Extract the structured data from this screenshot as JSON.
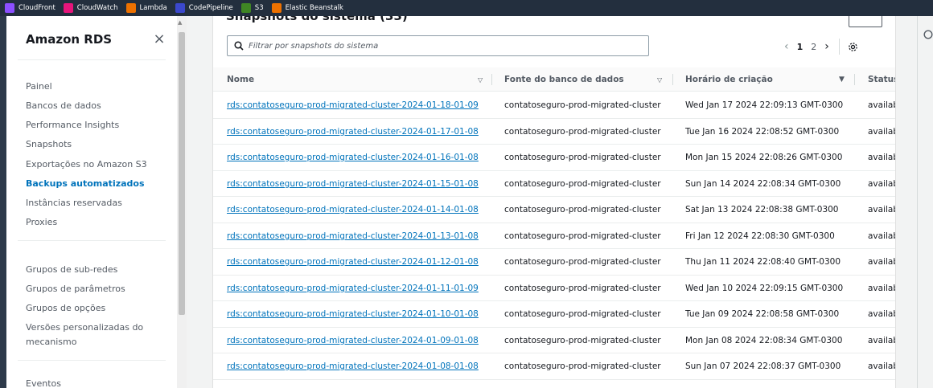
{
  "favorites": [
    {
      "label": "CloudFront",
      "color": "#8c4fff"
    },
    {
      "label": "CloudWatch",
      "color": "#e7157b"
    },
    {
      "label": "Lambda",
      "color": "#ed7100"
    },
    {
      "label": "CodePipeline",
      "color": "#3b48cc"
    },
    {
      "label": "S3",
      "color": "#3f8624"
    },
    {
      "label": "Elastic Beanstalk",
      "color": "#ed7100"
    }
  ],
  "sidebar": {
    "title": "Amazon RDS",
    "close_icon": "×",
    "items": [
      {
        "label": "Painel"
      },
      {
        "label": "Bancos de dados"
      },
      {
        "label": "Performance Insights"
      },
      {
        "label": "Snapshots"
      },
      {
        "label": "Exportações no Amazon S3"
      },
      {
        "label": "Backups automatizados",
        "active": true
      },
      {
        "label": "Instâncias reservadas"
      },
      {
        "label": "Proxies"
      }
    ],
    "items2": [
      {
        "label": "Grupos de sub-redes"
      },
      {
        "label": "Grupos de parâmetros"
      },
      {
        "label": "Grupos de opções"
      },
      {
        "label": "Versões personalizadas do"
      },
      {
        "label": "mecanismo"
      }
    ],
    "items3": [
      {
        "label": "Eventos"
      }
    ]
  },
  "main": {
    "header": "Snapshots do sistema (33)",
    "search_placeholder": "Filtrar por snapshots do sistema",
    "pagination": {
      "prev": "‹",
      "pages": [
        "1",
        "2"
      ],
      "current": "1",
      "next": "›"
    },
    "columns": [
      "Nome",
      "Fonte do banco de dados",
      "Horário de criação",
      "Status"
    ],
    "rows": [
      {
        "name": "rds:contatoseguro-prod-migrated-cluster-2024-01-18-01-09",
        "source": "contatoseguro-prod-migrated-cluster",
        "created": "Wed Jan 17 2024 22:09:13 GMT-0300",
        "status": "available"
      },
      {
        "name": "rds:contatoseguro-prod-migrated-cluster-2024-01-17-01-08",
        "source": "contatoseguro-prod-migrated-cluster",
        "created": "Tue Jan 16 2024 22:08:52 GMT-0300",
        "status": "available"
      },
      {
        "name": "rds:contatoseguro-prod-migrated-cluster-2024-01-16-01-08",
        "source": "contatoseguro-prod-migrated-cluster",
        "created": "Mon Jan 15 2024 22:08:26 GMT-0300",
        "status": "available"
      },
      {
        "name": "rds:contatoseguro-prod-migrated-cluster-2024-01-15-01-08",
        "source": "contatoseguro-prod-migrated-cluster",
        "created": "Sun Jan 14 2024 22:08:34 GMT-0300",
        "status": "available"
      },
      {
        "name": "rds:contatoseguro-prod-migrated-cluster-2024-01-14-01-08",
        "source": "contatoseguro-prod-migrated-cluster",
        "created": "Sat Jan 13 2024 22:08:38 GMT-0300",
        "status": "available"
      },
      {
        "name": "rds:contatoseguro-prod-migrated-cluster-2024-01-13-01-08",
        "source": "contatoseguro-prod-migrated-cluster",
        "created": "Fri Jan 12 2024 22:08:30 GMT-0300",
        "status": "available"
      },
      {
        "name": "rds:contatoseguro-prod-migrated-cluster-2024-01-12-01-08",
        "source": "contatoseguro-prod-migrated-cluster",
        "created": "Thu Jan 11 2024 22:08:40 GMT-0300",
        "status": "available"
      },
      {
        "name": "rds:contatoseguro-prod-migrated-cluster-2024-01-11-01-09",
        "source": "contatoseguro-prod-migrated-cluster",
        "created": "Wed Jan 10 2024 22:09:15 GMT-0300",
        "status": "available"
      },
      {
        "name": "rds:contatoseguro-prod-migrated-cluster-2024-01-10-01-08",
        "source": "contatoseguro-prod-migrated-cluster",
        "created": "Tue Jan 09 2024 22:08:58 GMT-0300",
        "status": "available"
      },
      {
        "name": "rds:contatoseguro-prod-migrated-cluster-2024-01-09-01-08",
        "source": "contatoseguro-prod-migrated-cluster",
        "created": "Mon Jan 08 2024 22:08:34 GMT-0300",
        "status": "available"
      },
      {
        "name": "rds:contatoseguro-prod-migrated-cluster-2024-01-08-01-08",
        "source": "contatoseguro-prod-migrated-cluster",
        "created": "Sun Jan 07 2024 22:08:37 GMT-0300",
        "status": "available"
      }
    ]
  },
  "icons": {
    "search": "search-icon",
    "settings": "gear-icon",
    "sort": "sort-caret-icon",
    "sort_active": "sort-down-icon"
  }
}
